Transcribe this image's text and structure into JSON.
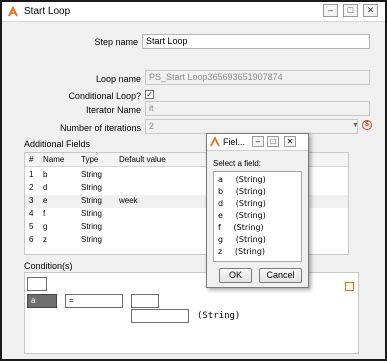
{
  "window": {
    "title": "Start Loop"
  },
  "form": {
    "step_name_label": "Step name",
    "step_name_value": "Start Loop",
    "loop_name_label": "Loop name",
    "loop_name_value": "PS_Start Loop365693651907874",
    "conditional_label": "Conditional Loop?",
    "conditional_checked": "✓",
    "iterator_label": "Iterator Name",
    "iterator_value": "it",
    "iterations_label": "Number of iterations",
    "iterations_value": "2"
  },
  "fields": {
    "title": "Additional Fields",
    "headers": {
      "num": "#",
      "name": "Name",
      "type": "Type",
      "default": "Default value"
    },
    "rows": [
      {
        "num": "1",
        "name": "b",
        "type": "String",
        "default": ""
      },
      {
        "num": "2",
        "name": "d",
        "type": "String",
        "default": ""
      },
      {
        "num": "3",
        "name": "e",
        "type": "String",
        "default": "week"
      },
      {
        "num": "4",
        "name": "f",
        "type": "String",
        "default": ""
      },
      {
        "num": "5",
        "name": "g",
        "type": "String",
        "default": ""
      },
      {
        "num": "6",
        "name": "z",
        "type": "String",
        "default": ""
      }
    ]
  },
  "condition": {
    "title": "Condition(s)",
    "field": "a",
    "operator": "=",
    "type": "(String)"
  },
  "dialog": {
    "title": "Fiel...",
    "prompt": "Select a field:",
    "items": [
      "a     (String)",
      "b     (String)",
      "d     (String)",
      "e     (String)",
      "f     (String)",
      "g     (String)",
      "z     (String)"
    ],
    "ok": "OK",
    "cancel": "Cancel"
  },
  "colors": {
    "accent": "#e8701a",
    "check": "#1a1a1a"
  }
}
